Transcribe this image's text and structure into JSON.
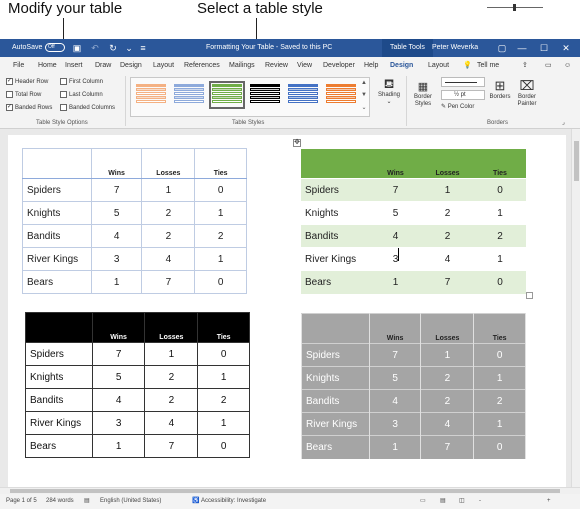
{
  "callouts": {
    "modify": "Modify your table",
    "select": "Select a table style"
  },
  "titlebar": {
    "autosave_label": "AutoSave",
    "autosave_state": "Off",
    "doc_title": "Formatting Your Table  -  Saved to this PC",
    "context_tab": "Table Tools",
    "user_name": "Peter Weverka",
    "icons": [
      "save-icon",
      "undo-icon",
      "redo-icon",
      "customize-icon",
      "ribbon-display-icon",
      "minimize-icon",
      "maximize-icon",
      "close-icon"
    ]
  },
  "ribbon_tabs": [
    "File",
    "Home",
    "Insert",
    "Draw",
    "Design",
    "Layout",
    "References",
    "Mailings",
    "Review",
    "View",
    "Developer",
    "Help",
    "Design",
    "Layout",
    "Tell me"
  ],
  "ribbon_active_tab_index": 12,
  "style_options": {
    "items": [
      {
        "label": "Header Row",
        "checked": true
      },
      {
        "label": "Total Row",
        "checked": false
      },
      {
        "label": "Banded Rows",
        "checked": true
      },
      {
        "label": "First Column",
        "checked": false
      },
      {
        "label": "Last Column",
        "checked": false
      },
      {
        "label": "Banded Columns",
        "checked": false
      }
    ],
    "group_label": "Table Style Options"
  },
  "table_styles": {
    "group_label": "Table Styles",
    "swatch_colors": [
      "#f4b183",
      "#8eaadb",
      "#70ad47",
      "#000000",
      "#4472c4",
      "#ed7d31"
    ],
    "selected_index": 2
  },
  "shading": {
    "label": "Shading"
  },
  "borders_group": {
    "group_label": "Borders",
    "border_styles": "Border Styles",
    "pen_weight": "½ pt",
    "pen_color": "Pen Color",
    "borders": "Borders",
    "border_painter": "Border Painter"
  },
  "tables": {
    "headers": [
      "",
      "Wins",
      "Losses",
      "Ties"
    ],
    "rows": [
      {
        "team": "Spiders",
        "wins": "7",
        "losses": "1",
        "ties": "0"
      },
      {
        "team": "Knights",
        "wins": "5",
        "losses": "2",
        "ties": "1"
      },
      {
        "team": "Bandits",
        "wins": "4",
        "losses": "2",
        "ties": "2"
      },
      {
        "team": "River Kings",
        "wins": "3",
        "losses": "4",
        "ties": "1"
      },
      {
        "team": "Bears",
        "wins": "1",
        "losses": "7",
        "ties": "0"
      }
    ]
  },
  "statusbar": {
    "page": "Page 1 of 5",
    "words": "284 words",
    "language": "English (United States)",
    "accessibility": "Accessibility: Investigate",
    "zoom_minus": "-",
    "zoom_plus": "+"
  }
}
